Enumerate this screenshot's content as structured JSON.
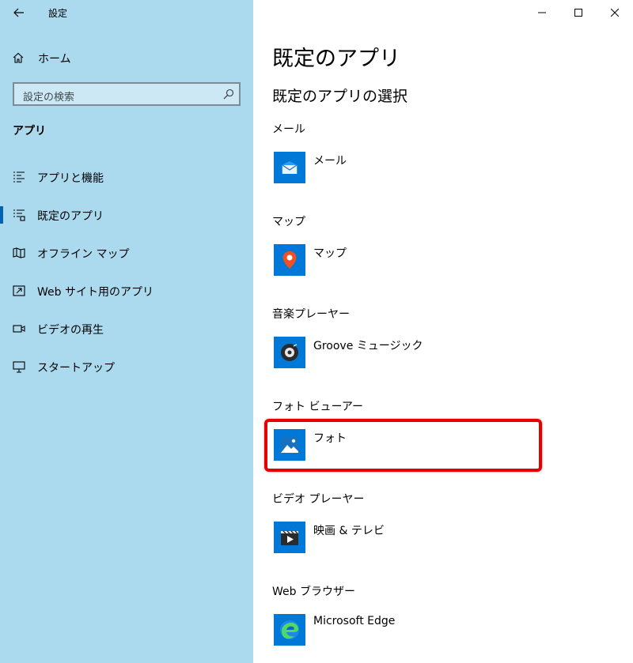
{
  "window": {
    "app_title": "設定"
  },
  "nav": {
    "home_label": "ホーム",
    "search_placeholder": "設定の検索",
    "section_title": "アプリ",
    "items": [
      {
        "label": "アプリと機能",
        "icon": "apps-features-icon",
        "selected": false
      },
      {
        "label": "既定のアプリ",
        "icon": "default-apps-icon",
        "selected": true
      },
      {
        "label": "オフライン マップ",
        "icon": "offline-maps-icon",
        "selected": false
      },
      {
        "label": "Web サイト用のアプリ",
        "icon": "apps-for-websites-icon",
        "selected": false
      },
      {
        "label": "ビデオの再生",
        "icon": "video-playback-icon",
        "selected": false
      },
      {
        "label": "スタートアップ",
        "icon": "startup-icon",
        "selected": false
      }
    ]
  },
  "main": {
    "page_title": "既定のアプリ",
    "subtitle": "既定のアプリの選択",
    "defaults": [
      {
        "category": "メール",
        "app": "メール",
        "icon": "mail-icon"
      },
      {
        "category": "マップ",
        "app": "マップ",
        "icon": "maps-icon"
      },
      {
        "category": "音楽プレーヤー",
        "app": "Groove ミュージック",
        "icon": "groove-music-icon"
      },
      {
        "category": "フォト ビューアー",
        "app": "フォト",
        "icon": "photos-icon"
      },
      {
        "category": "ビデオ プレーヤー",
        "app": "映画 & テレビ",
        "icon": "movies-tv-icon"
      },
      {
        "category": "Web ブラウザー",
        "app": "Microsoft Edge",
        "icon": "edge-icon"
      }
    ]
  },
  "colors": {
    "nav_bg": "#abdaef",
    "accent": "#0078d7",
    "highlight": "#e60000"
  }
}
